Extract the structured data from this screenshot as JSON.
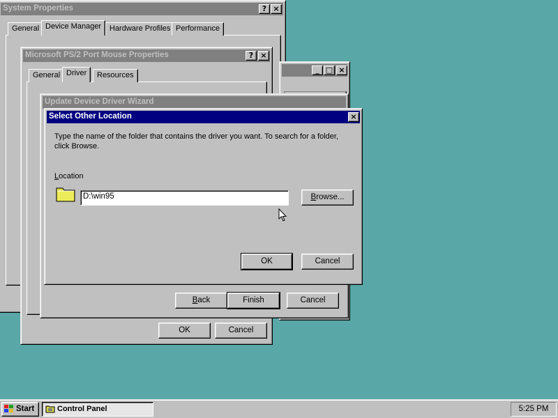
{
  "system_properties": {
    "title": "System Properties",
    "tabs": [
      "General",
      "Device Manager",
      "Hardware Profiles",
      "Performance"
    ]
  },
  "background_window": {
    "buttons": [
      "_",
      "□",
      "×"
    ]
  },
  "mouse_properties": {
    "title": "Microsoft PS/2 Port Mouse Properties",
    "tabs": [
      "General",
      "Driver",
      "Resources"
    ],
    "ok_label": "OK",
    "cancel_label": "Cancel"
  },
  "wizard": {
    "title": "Update Device Driver Wizard",
    "back_label": "< Back",
    "finish_label": "Finish",
    "cancel_label": "Cancel"
  },
  "select_location": {
    "title": "Select Other Location",
    "instructions": "Type the name of the folder that contains the driver you want. To search for a folder, click Browse.",
    "location_label": "Location",
    "location_value": "D:\\win95",
    "browse_label": "Browse...",
    "ok_label": "OK",
    "cancel_label": "Cancel"
  },
  "titlebar_buttons": {
    "help": "?",
    "close": "×"
  },
  "taskbar": {
    "start_label": "Start",
    "task_label": "Control Panel",
    "clock": "5:25 PM"
  },
  "colors": {
    "desktop": "#5aa7a7",
    "active_title": "#000080",
    "inactive_title": "#808080",
    "face": "#c0c0c0"
  }
}
